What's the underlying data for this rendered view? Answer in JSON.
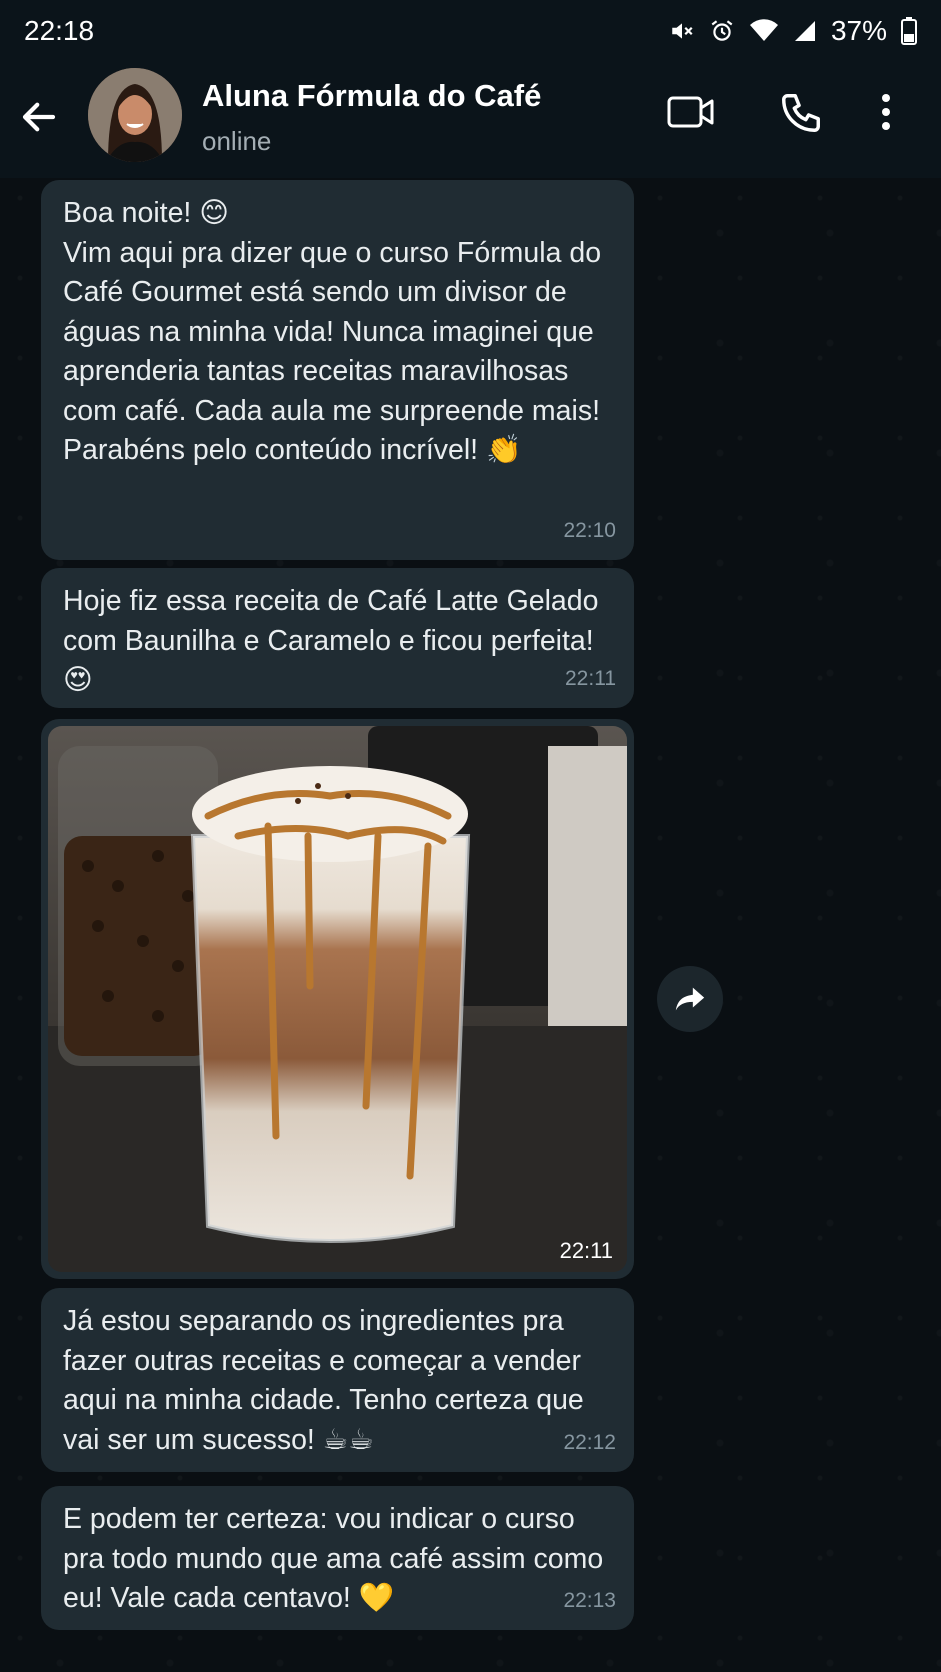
{
  "status_bar": {
    "time": "22:18",
    "battery": "37%",
    "icons": [
      "mute-icon",
      "alarm-icon",
      "wifi-icon",
      "signal-icon",
      "battery-icon"
    ]
  },
  "header": {
    "contact_name": "Aluna Fórmula do Café",
    "status": "online",
    "icons": [
      "back-arrow-icon",
      "video-call-icon",
      "voice-call-icon",
      "more-options-icon"
    ]
  },
  "messages": [
    {
      "text": "Boa noite! 😊\nVim aqui pra dizer que o curso Fórmula do Café Gourmet está sendo um divisor de águas na minha vida! Nunca imaginei que aprenderia tantas receitas maravilhosas com café. Cada aula me surpreende mais! Parabéns pelo conteúdo incrível! 👏",
      "time": "22:10"
    },
    {
      "text": "Hoje fiz essa receita de Café Latte Gelado com Baunilha e Caramelo e ficou perfeita! 😍",
      "time": "22:11"
    },
    {
      "image": "iced-caramel-latte-photo",
      "time": "22:11"
    },
    {
      "text": "Já estou separando os ingredientes pra fazer outras receitas e começar a vender aqui na minha cidade. Tenho certeza que vai ser um sucesso! ☕☕",
      "time": "22:12"
    },
    {
      "text": "E podem ter certeza: vou indicar o curso pra todo mundo que ama café assim como eu! Vale cada centavo! 💛",
      "time": "22:13"
    }
  ],
  "colors": {
    "bubble": "#202c33",
    "background": "#0b141a",
    "meta_text": "#8696a0"
  }
}
